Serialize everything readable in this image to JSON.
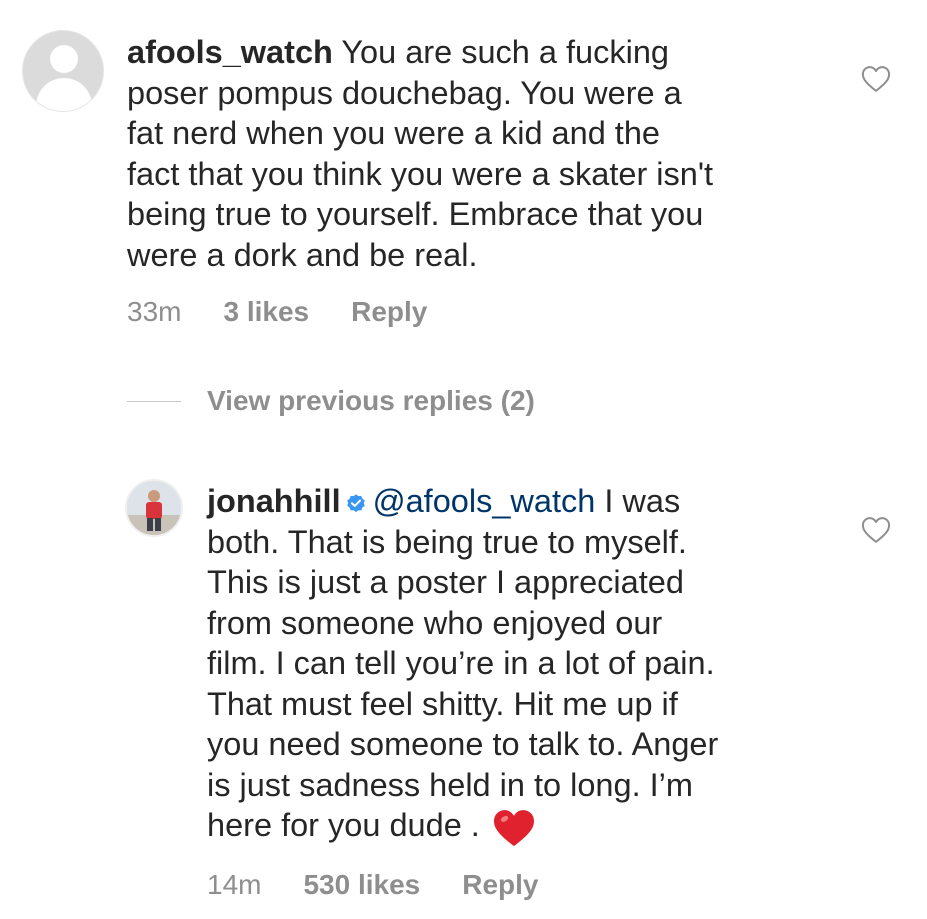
{
  "comments": [
    {
      "username": "afools_watch",
      "verified": false,
      "lines": [
        "You are such a fucking",
        "poser pompus douchebag. You were a",
        "fat nerd when you were a kid and the",
        "fact that you think you were a skater isn't",
        "being true to yourself. Embrace that you",
        "were a dork and be real."
      ],
      "time": "33m",
      "likes": "3 likes",
      "reply_label": "Reply",
      "like_icon": "heart-outline-icon"
    },
    {
      "username": "jonahhill",
      "verified": true,
      "mention": "@afools_watch",
      "lines": [
        "I was",
        "both. That is being true to myself.",
        "This is just a poster I appreciated",
        "from someone who enjoyed our",
        "film. I can tell you’re in a lot of pain.",
        "That must feel shitty. Hit me up if",
        "you need someone to talk to. Anger",
        "is just sadness held in to long. I’m",
        "here for you dude ."
      ],
      "trailing_emoji": "red-heart",
      "time": "14m",
      "likes": "530 likes",
      "reply_label": "Reply",
      "like_icon": "heart-outline-icon"
    }
  ],
  "view_previous_replies": "View previous replies (2)",
  "colors": {
    "text": "#262626",
    "muted": "#8e8e8e",
    "mention": "#003569",
    "verified": "#3897f0",
    "emoji_heart": "#e0212e"
  }
}
